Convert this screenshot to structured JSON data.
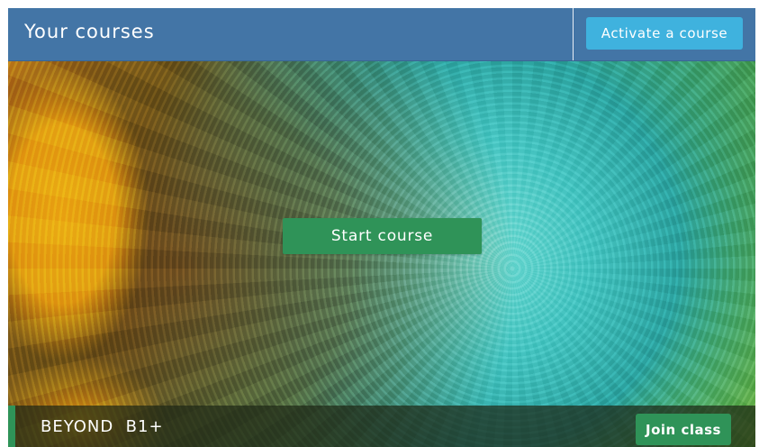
{
  "header": {
    "title": "Your courses",
    "activate_label": "Activate a course"
  },
  "course": {
    "name": "BEYOND  B1+",
    "start_label": "Start course",
    "join_label": "Join class",
    "image": "sunflower-closeup"
  },
  "colors": {
    "header_bg": "#4375a6",
    "activate_button": "#3fb2de",
    "primary_green": "#2f9358",
    "footer_overlay": "rgba(30,40,22,0.72)"
  }
}
